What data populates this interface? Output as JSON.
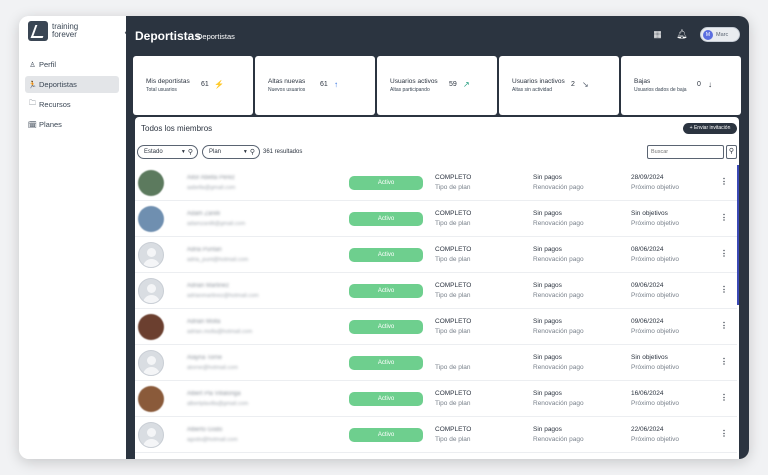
{
  "sidebar": {
    "logo_line1": "training",
    "logo_line2": "forever",
    "collapse_glyph": "‹",
    "items": [
      {
        "label": "Perfil",
        "icon": "user-icon",
        "glyph": "♙"
      },
      {
        "label": "Deportistas",
        "icon": "runner-icon",
        "glyph": "🏃"
      },
      {
        "label": "Recursos",
        "icon": "book-icon",
        "glyph": "🗀"
      },
      {
        "label": "Planes",
        "icon": "calendar-icon",
        "glyph": "🗓"
      }
    ]
  },
  "header": {
    "title": "Deportistas",
    "subtitle": "Deportistas",
    "user_name": "Marc",
    "user_initial": "M"
  },
  "stats": [
    {
      "title": "Mis deportistas",
      "sub": "Total usuarios",
      "value": "61",
      "icon": "⚡",
      "icon_color": "#f5b400"
    },
    {
      "title": "Altas nuevas",
      "sub": "Nuevos usuarios",
      "value": "61",
      "icon": "↑",
      "icon_color": "#2f6fe0"
    },
    {
      "title": "Usuarios activos",
      "sub": "Altas participando",
      "value": "59",
      "icon": "↗",
      "icon_color": "#1a9a7a"
    },
    {
      "title": "Usuarios inactivos",
      "sub": "Altas sin actividad",
      "value": "2",
      "icon": "↘",
      "icon_color": "#5a6472"
    },
    {
      "title": "Bajas",
      "sub": "Usuarios dados de baja",
      "value": "0",
      "icon": "↓",
      "icon_color": "#2c3440"
    }
  ],
  "members": {
    "title": "Todos los miembros",
    "invite_label": "+ Enviar invitación",
    "filter_estado": "Estado",
    "filter_plan": "Plan",
    "results": "361 resultados",
    "search_placeholder": "Buscar",
    "rows": [
      {
        "name": "Aitor Abella Perez",
        "email": "aabella@gmail.com",
        "status": "Activo",
        "plan": "COMPLETO",
        "plan_sub": "Tipo de plan",
        "pay": "Sin pagos",
        "pay_sub": "Renovación pago",
        "goal": "28/09/2024",
        "goal_sub": "Próximo objetivo",
        "avatar": "photo",
        "avatar_color": "#5c7a5e"
      },
      {
        "name": "Adam Zanilli",
        "email": "adamzanilli@gmail.com",
        "status": "Activo",
        "plan": "COMPLETO",
        "plan_sub": "Tipo de plan",
        "pay": "Sin pagos",
        "pay_sub": "Renovación pago",
        "goal": "Sin objetivos",
        "goal_sub": "Próximo objetivo",
        "avatar": "photo",
        "avatar_color": "#6f8fb0"
      },
      {
        "name": "Adria Puntan",
        "email": "adria_punt@hotmail.com",
        "status": "Activo",
        "plan": "COMPLETO",
        "plan_sub": "Tipo de plan",
        "pay": "Sin pagos",
        "pay_sub": "Renovación pago",
        "goal": "08/06/2024",
        "goal_sub": "Próximo objetivo",
        "avatar": "ph",
        "avatar_color": ""
      },
      {
        "name": "Adrian Martinez",
        "email": "adrianmartinez@hotmail.com",
        "status": "Activo",
        "plan": "COMPLETO",
        "plan_sub": "Tipo de plan",
        "pay": "Sin pagos",
        "pay_sub": "Renovación pago",
        "goal": "09/06/2024",
        "goal_sub": "Próximo objetivo",
        "avatar": "ph",
        "avatar_color": ""
      },
      {
        "name": "Adrian Molla",
        "email": "adrian.molla@hotmail.com",
        "status": "Activo",
        "plan": "COMPLETO",
        "plan_sub": "Tipo de plan",
        "pay": "Sin pagos",
        "pay_sub": "Renovación pago",
        "goal": "09/06/2024",
        "goal_sub": "Próximo objetivo",
        "avatar": "photo",
        "avatar_color": "#6b3f2f"
      },
      {
        "name": "Alayna Torne",
        "email": "atorne@hotmail.com",
        "status": "Activo",
        "plan": "",
        "plan_sub": "Tipo de plan",
        "pay": "Sin pagos",
        "pay_sub": "Renovación pago",
        "goal": "Sin objetivos",
        "goal_sub": "Próximo objetivo",
        "avatar": "ph",
        "avatar_color": ""
      },
      {
        "name": "Albert Pla Villalonga",
        "email": "albertplavilla@gmail.com",
        "status": "Activo",
        "plan": "COMPLETO",
        "plan_sub": "Tipo de plan",
        "pay": "Sin pagos",
        "pay_sub": "Renovación pago",
        "goal": "16/06/2024",
        "goal_sub": "Próximo objetivo",
        "avatar": "photo",
        "avatar_color": "#8a5a3a"
      },
      {
        "name": "Alberto Godo",
        "email": "agodo@hotmail.com",
        "status": "Activo",
        "plan": "COMPLETO",
        "plan_sub": "Tipo de plan",
        "pay": "Sin pagos",
        "pay_sub": "Renovación pago",
        "goal": "22/06/2024",
        "goal_sub": "Próximo objetivo",
        "avatar": "ph",
        "avatar_color": ""
      }
    ]
  },
  "colors": {
    "main_bg": "#2b3440",
    "badge_green": "#6ecf8e",
    "scroll_accent": "#3b49b5"
  }
}
